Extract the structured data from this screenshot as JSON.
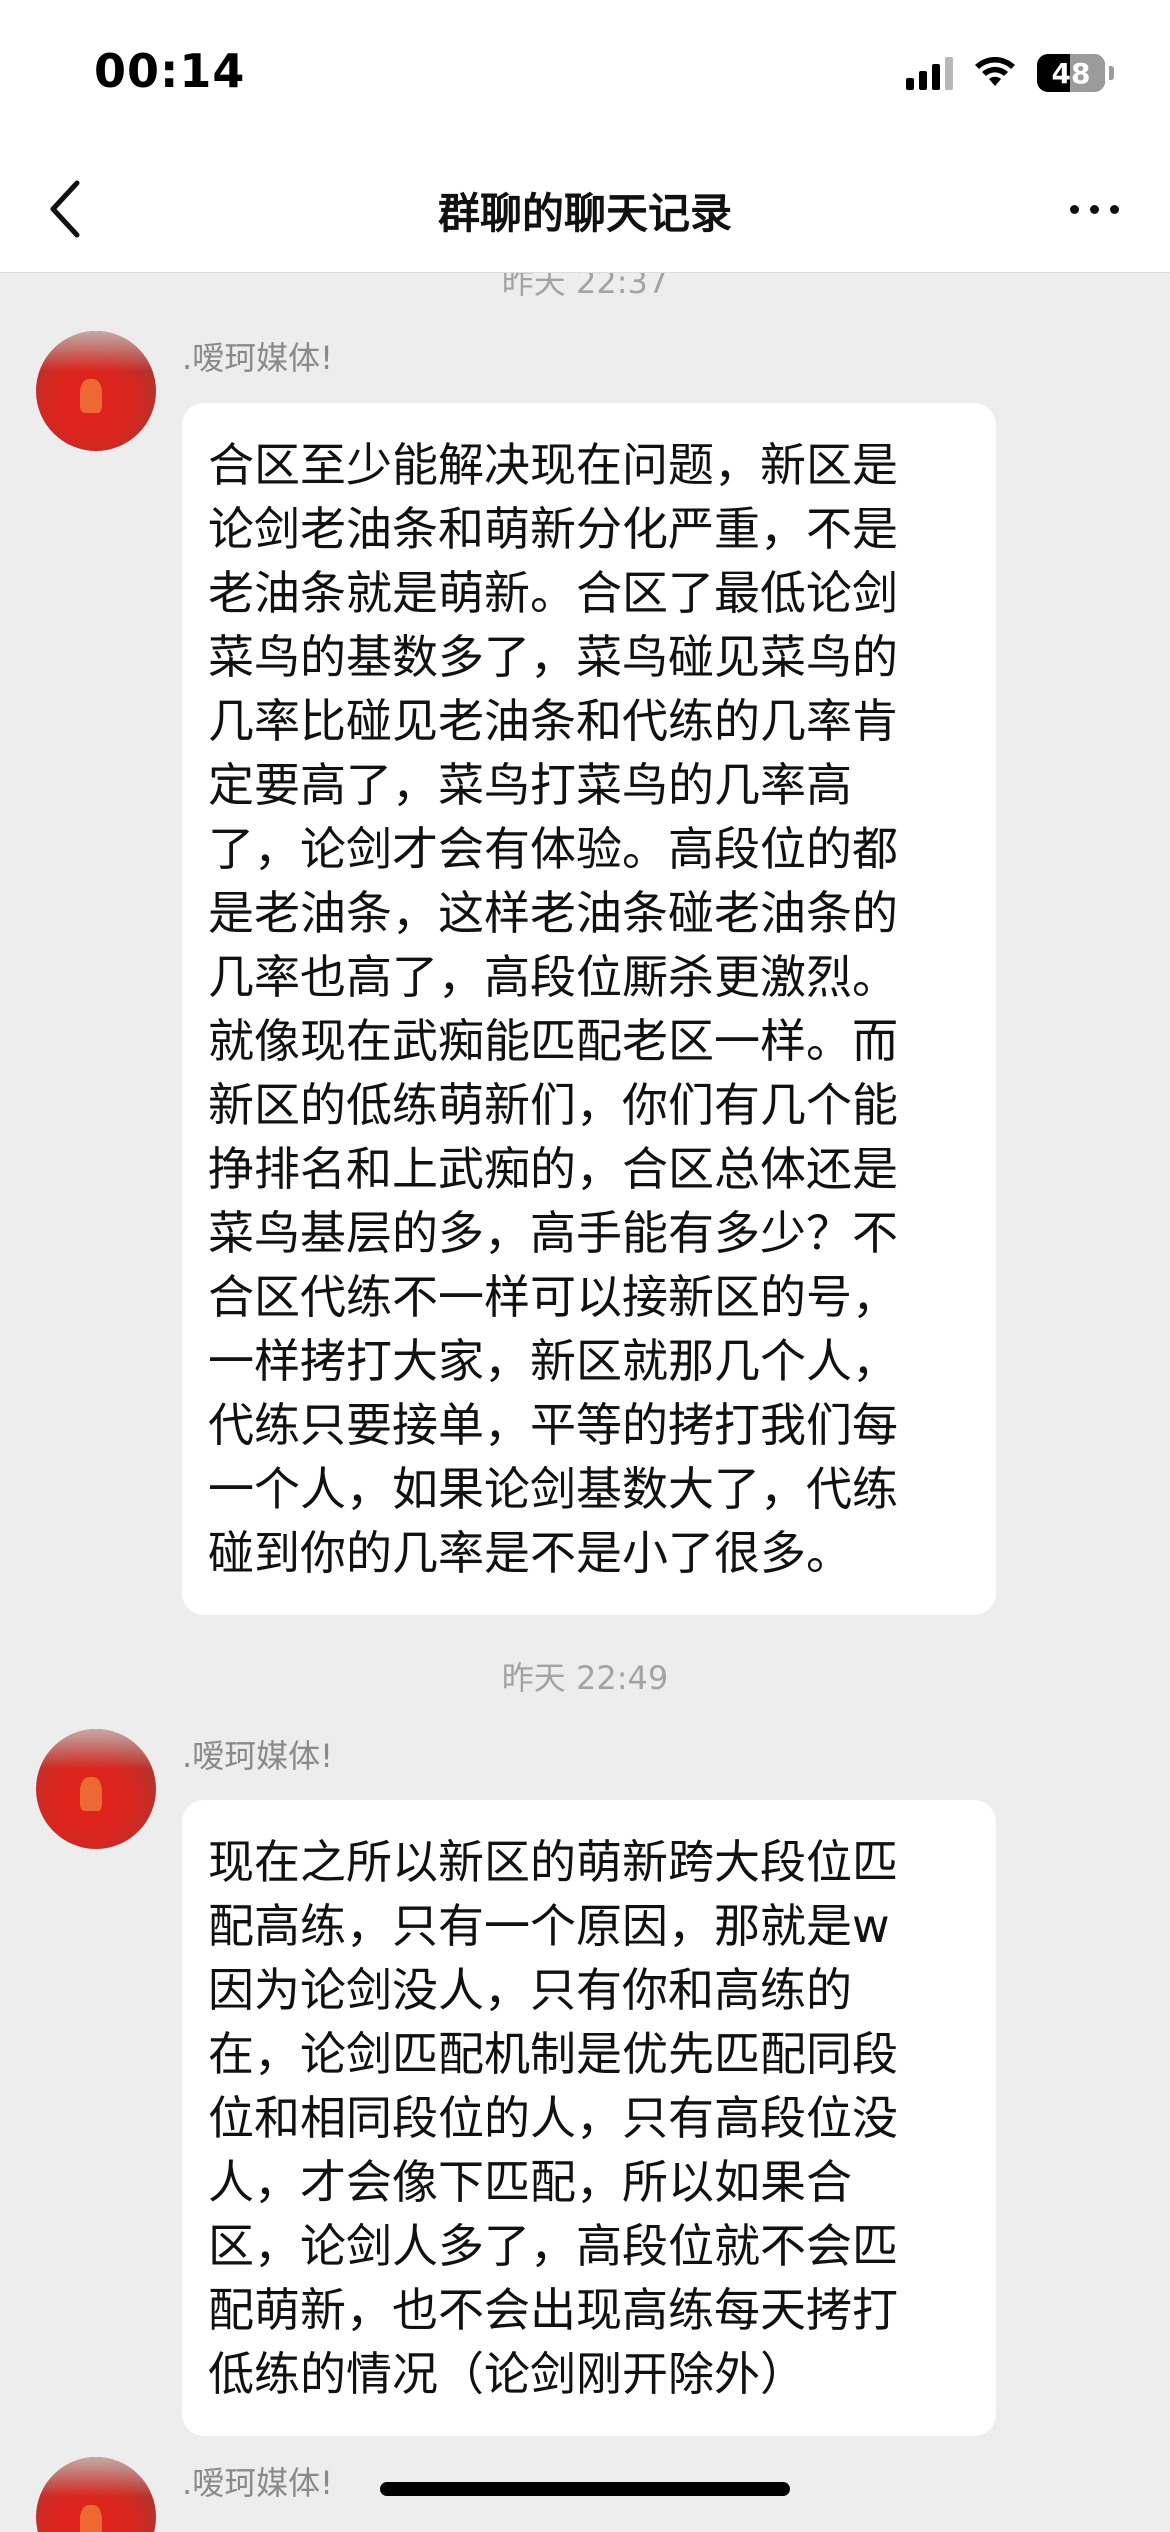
{
  "status_bar": {
    "time": "00:14",
    "battery_level": "48",
    "signal_bars_active": 3,
    "signal_bars_total": 4
  },
  "nav": {
    "title": "群聊的聊天记录",
    "back_icon": "chevron-left-icon",
    "more_icon": "more-dots-icon"
  },
  "messages": [
    {
      "timestamp": "昨天 22:37",
      "sender": ".嗳珂媒体!",
      "text": "合区至少能解决现在问题，新区是\n论剑老油条和萌新分化严重，不是\n老油条就是萌新。合区了最低论剑\n菜鸟的基数多了，菜鸟碰见菜鸟的\n几率比碰见老油条和代练的几率肯\n定要高了，菜鸟打菜鸟的几率高\n了，论剑才会有体验。高段位的都\n是老油条，这样老油条碰老油条的\n几率也高了，高段位厮杀更激烈。\n就像现在武痴能匹配老区一样。而\n新区的低练萌新们，你们有几个能\n挣排名和上武痴的，合区总体还是\n菜鸟基层的多，高手能有多少？不\n合区代练不一样可以接新区的号，\n一样拷打大家，新区就那几个人，\n代练只要接单，平等的拷打我们每\n一个人，如果论剑基数大了，代练\n碰到你的几率是不是小了很多。"
    },
    {
      "timestamp": "昨天 22:49",
      "sender": ".嗳珂媒体!",
      "text": "现在之所以新区的萌新跨大段位匹\n配高练，只有一个原因，那就是w\n因为论剑没人，只有你和高练的\n在，论剑匹配机制是优先匹配同段\n位和相同段位的人，只有高段位没\n人，才会像下匹配，所以如果合\n区，论剑人多了，高段位就不会匹\n配萌新，也不会出现高练每天拷打\n低练的情况（论剑刚开除外）"
    },
    {
      "timestamp": "",
      "sender": ".嗳珂媒体!",
      "text": ""
    }
  ]
}
